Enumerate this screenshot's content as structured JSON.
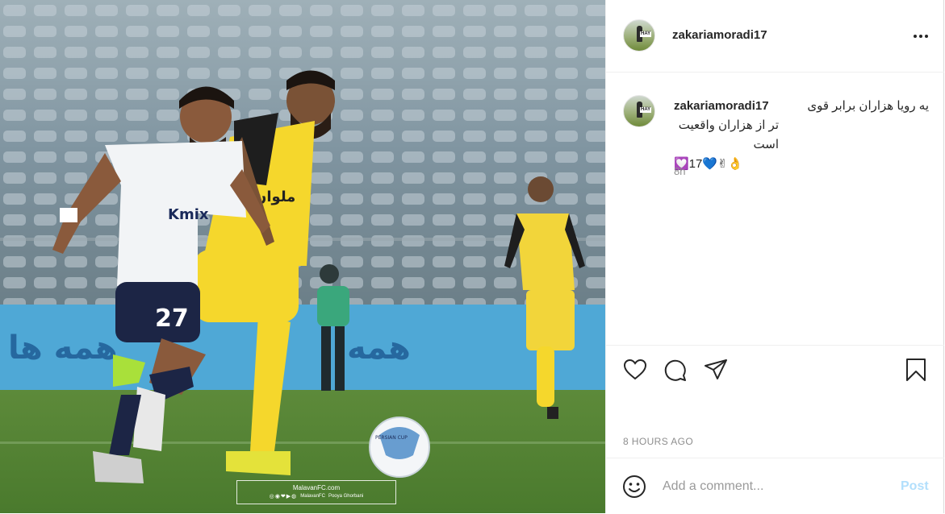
{
  "post": {
    "username": "zakariamoradi17",
    "caption_line1": "یه رویا هزاران برابر قوی",
    "caption_line2": "تر از هزاران واقعیت است",
    "caption_line3": "💟17💙✌👌",
    "time_short": "8h",
    "time_full": "8 HOURS AGO"
  },
  "photo": {
    "player_number": "27",
    "shirt_sponsor": "Kmix",
    "banner_text": "همه ها",
    "watermark_site": "MalavanFC.com",
    "watermark_icons": "◎◉❤▶◍",
    "watermark_brand": "MalavanFC",
    "watermark_credit": "Pooya Ghorbani",
    "ball_text": "PERSIAN CUP"
  },
  "avatar": {
    "sign_text": "HAY"
  },
  "composer": {
    "placeholder": "Add a comment...",
    "post_label": "Post"
  },
  "icons": {
    "more": "more-options-icon",
    "like": "heart-icon",
    "comment": "comment-bubble-icon",
    "share": "paper-plane-icon",
    "save": "bookmark-icon",
    "emoji": "smiley-icon"
  },
  "colors": {
    "text": "#262626",
    "muted": "#8e8e8e",
    "post_button_disabled": "#b2dffc",
    "divider": "#efefef"
  }
}
